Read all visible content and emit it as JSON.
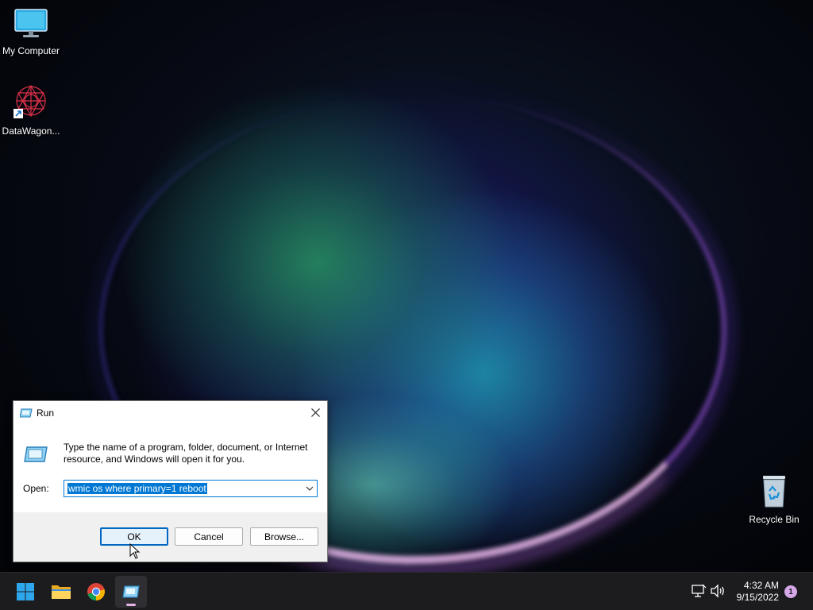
{
  "desktop": {
    "icons": [
      {
        "label": "My Computer",
        "icon": "monitor-icon"
      },
      {
        "label": "DataWagon...",
        "icon": "datawagon-app-icon"
      },
      {
        "label": "Recycle Bin",
        "icon": "recycle-bin-icon"
      }
    ]
  },
  "run_dialog": {
    "title": "Run",
    "prompt": "Type the name of a program, folder, document, or Internet resource, and Windows will open it for you.",
    "open_label": "Open:",
    "open_value": "wmic os where primary=1 reboot",
    "buttons": {
      "ok": "OK",
      "cancel": "Cancel",
      "browse": "Browse..."
    }
  },
  "taskbar": {
    "apps": [
      "windows-start-icon",
      "file-explorer-icon",
      "chrome-icon",
      "run-app-icon"
    ],
    "time": "4:32 AM",
    "date": "9/15/2022",
    "notification_count": "1"
  },
  "colors": {
    "accent": "#0078d4",
    "taskbar": "#1c1c1f",
    "badge": "#d7a8e8"
  }
}
